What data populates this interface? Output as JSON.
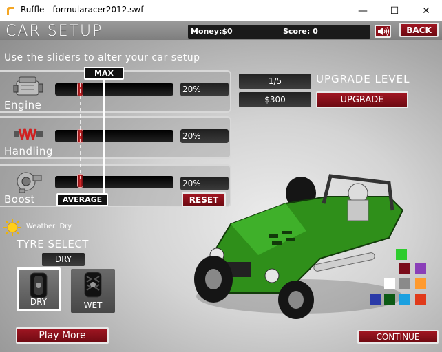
{
  "window": {
    "title": "Ruffle - formularacer2012.swf",
    "minimize": "—",
    "maximize": "☐",
    "close": "✕"
  },
  "header": {
    "title": "CAR SETUP",
    "money_label": "Money:$0",
    "score_label": "Score: 0",
    "back_label": "BACK"
  },
  "instructions": "Use the sliders to alter your car setup",
  "sliders": [
    {
      "label": "Engine",
      "value": "20%",
      "level": 0.2,
      "icon": "engine-icon"
    },
    {
      "label": "Handling",
      "value": "20%",
      "level": 0.2,
      "icon": "shock-absorber-icon"
    },
    {
      "label": "Boost",
      "value": "20%",
      "level": 0.2,
      "icon": "turbo-icon"
    }
  ],
  "markers": {
    "max_label": "MAX",
    "average_label": "AVERAGE"
  },
  "reset_label": "RESET",
  "upgrade": {
    "count": "1/5",
    "level_label": "UPGRADE LEVEL",
    "price": "$300",
    "button_label": "UPGRADE"
  },
  "weather": {
    "label": "Weather: Dry",
    "icon": "sun-icon"
  },
  "tyre_select": {
    "heading": "TYRE SELECT",
    "selected": "DRY",
    "options": [
      "DRY",
      "WET"
    ]
  },
  "play_more_label": "Play More",
  "continue_label": "CONTINUE",
  "car_colors": [
    "#2ecc2e",
    "#7a0c1a",
    "#8a3fb8",
    "#ffffff",
    "#8a8a8a",
    "#ff9a2e",
    "#2a3aa8",
    "#0c5a14",
    "#1aa0e0",
    "#e03a1a"
  ],
  "car_color_selected": "#2e8c1a"
}
